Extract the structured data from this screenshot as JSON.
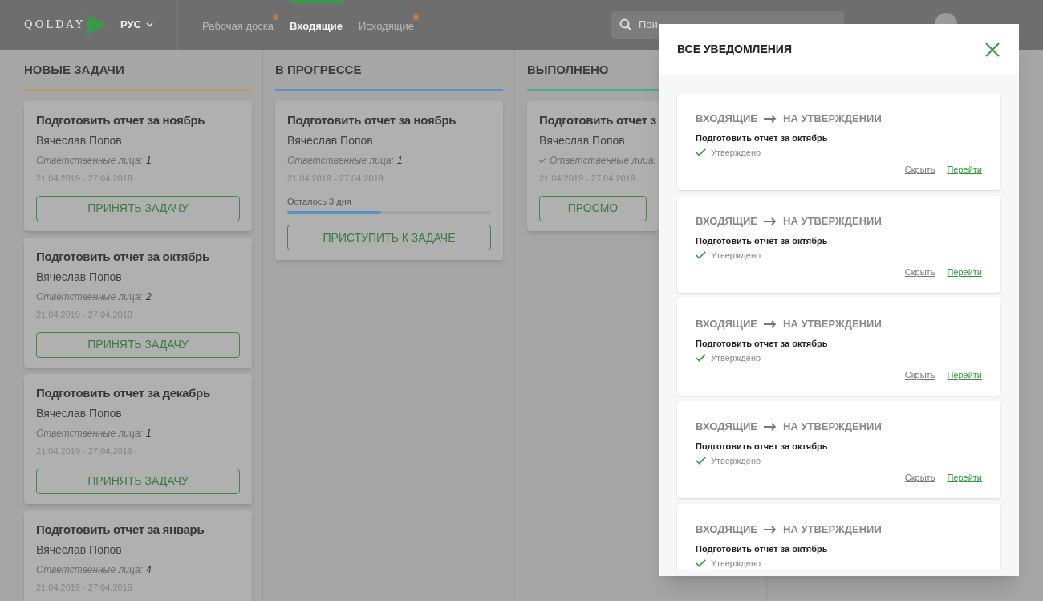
{
  "header": {
    "logo": "QOLDAY",
    "language": "РУС",
    "nav": [
      {
        "label": "Рабочая доска",
        "selected": false,
        "badge": true
      },
      {
        "label": "Входящие",
        "selected": true,
        "badge": false
      },
      {
        "label": "Исходящие",
        "selected": false,
        "badge": true
      }
    ],
    "search": {
      "placeholder": "Пои"
    }
  },
  "columns": [
    {
      "title": "НОВЫЕ ЗАДАЧИ",
      "color": "#c09a64",
      "cards": [
        {
          "title": "Подготовить отчет за ноябрь",
          "author": "Вячеслав Попов",
          "checked": false,
          "responsible_label": "Ответственные лица:",
          "responsible_count": "1",
          "dates": "21.04.2019 - 27.04.2019",
          "button": "ПРИНЯТЬ ЗАДАЧУ"
        },
        {
          "title": "Подготовить отчет за октябрь",
          "author": "Вячеслав Попов",
          "checked": false,
          "responsible_label": "Ответственные лица:",
          "responsible_count": "2",
          "dates": "21.04.2019 - 27.04.2019",
          "button": "ПРИНЯТЬ ЗАДАЧУ"
        },
        {
          "title": "Подготовить отчет за декабрь",
          "author": "Вячеслав Попов",
          "checked": false,
          "responsible_label": "Ответственные лица:",
          "responsible_count": "1",
          "dates": "21.04.2019 - 27.04.2019",
          "button": "ПРИНЯТЬ ЗАДАЧУ"
        },
        {
          "title": "Подготовить отчет за январь",
          "author": "Вячеслав Попов",
          "checked": false,
          "responsible_label": "Ответственные лица:",
          "responsible_count": "4",
          "dates": "21.04.2019 - 27.04.2019"
        }
      ]
    },
    {
      "title": "В ПРОГРЕССЕ",
      "color": "#5a92c8",
      "cards": [
        {
          "title": "Подготовить отчет за ноябрь",
          "author": "Вячеслав Попов",
          "checked": false,
          "responsible_label": "Ответственные лица:",
          "responsible_count": "1",
          "dates": "21.04.2019 - 27.04.2019",
          "progress": {
            "label": "Осталось 3 дня",
            "level": 0.46
          },
          "button": "ПРИСТУПИТЬ К ЗАДАЧЕ"
        }
      ]
    },
    {
      "title": "ВЫПОЛНЕНО",
      "color": "#4dae82",
      "cards": [
        {
          "title": "Подготовить отчет з",
          "author": "Вячеслав Попов",
          "checked": true,
          "responsible_label": "Ответственные лица:",
          "dates": "21.04.2019 - 27.04.2019",
          "button": "ПРОСМО"
        }
      ]
    }
  ],
  "modal": {
    "title": "ВСЕ УВЕДОМЛЕНИЯ",
    "notifications": [
      {
        "from": "ВХОДЯЩИЕ",
        "to": "НА УТВЕРЖДЕНИИ",
        "task": "Подготовить отчет за октябрь",
        "status": "Утверждено",
        "hide": "Скрыть",
        "go": "Перейти"
      },
      {
        "from": "ВХОДЯЩИЕ",
        "to": "НА УТВЕРЖДЕНИИ",
        "task": "Подготовить отчет за октябрь",
        "status": "Утверждено",
        "hide": "Скрыть",
        "go": "Перейти"
      },
      {
        "from": "ВХОДЯЩИЕ",
        "to": "НА УТВЕРЖДЕНИИ",
        "task": "Подготовить отчет за октябрь",
        "status": "Утверждено",
        "hide": "Скрыть",
        "go": "Перейти"
      },
      {
        "from": "ВХОДЯЩИЕ",
        "to": "НА УТВЕРЖДЕНИИ",
        "task": "Подготовить отчет за октябрь",
        "status": "Утверждено",
        "hide": "Скрыть",
        "go": "Перейти"
      },
      {
        "from": "ВХОДЯЩИЕ",
        "to": "НА УТВЕРЖДЕНИИ",
        "task": "Подготовить отчет за октябрь",
        "status": "Утверждено"
      }
    ]
  }
}
